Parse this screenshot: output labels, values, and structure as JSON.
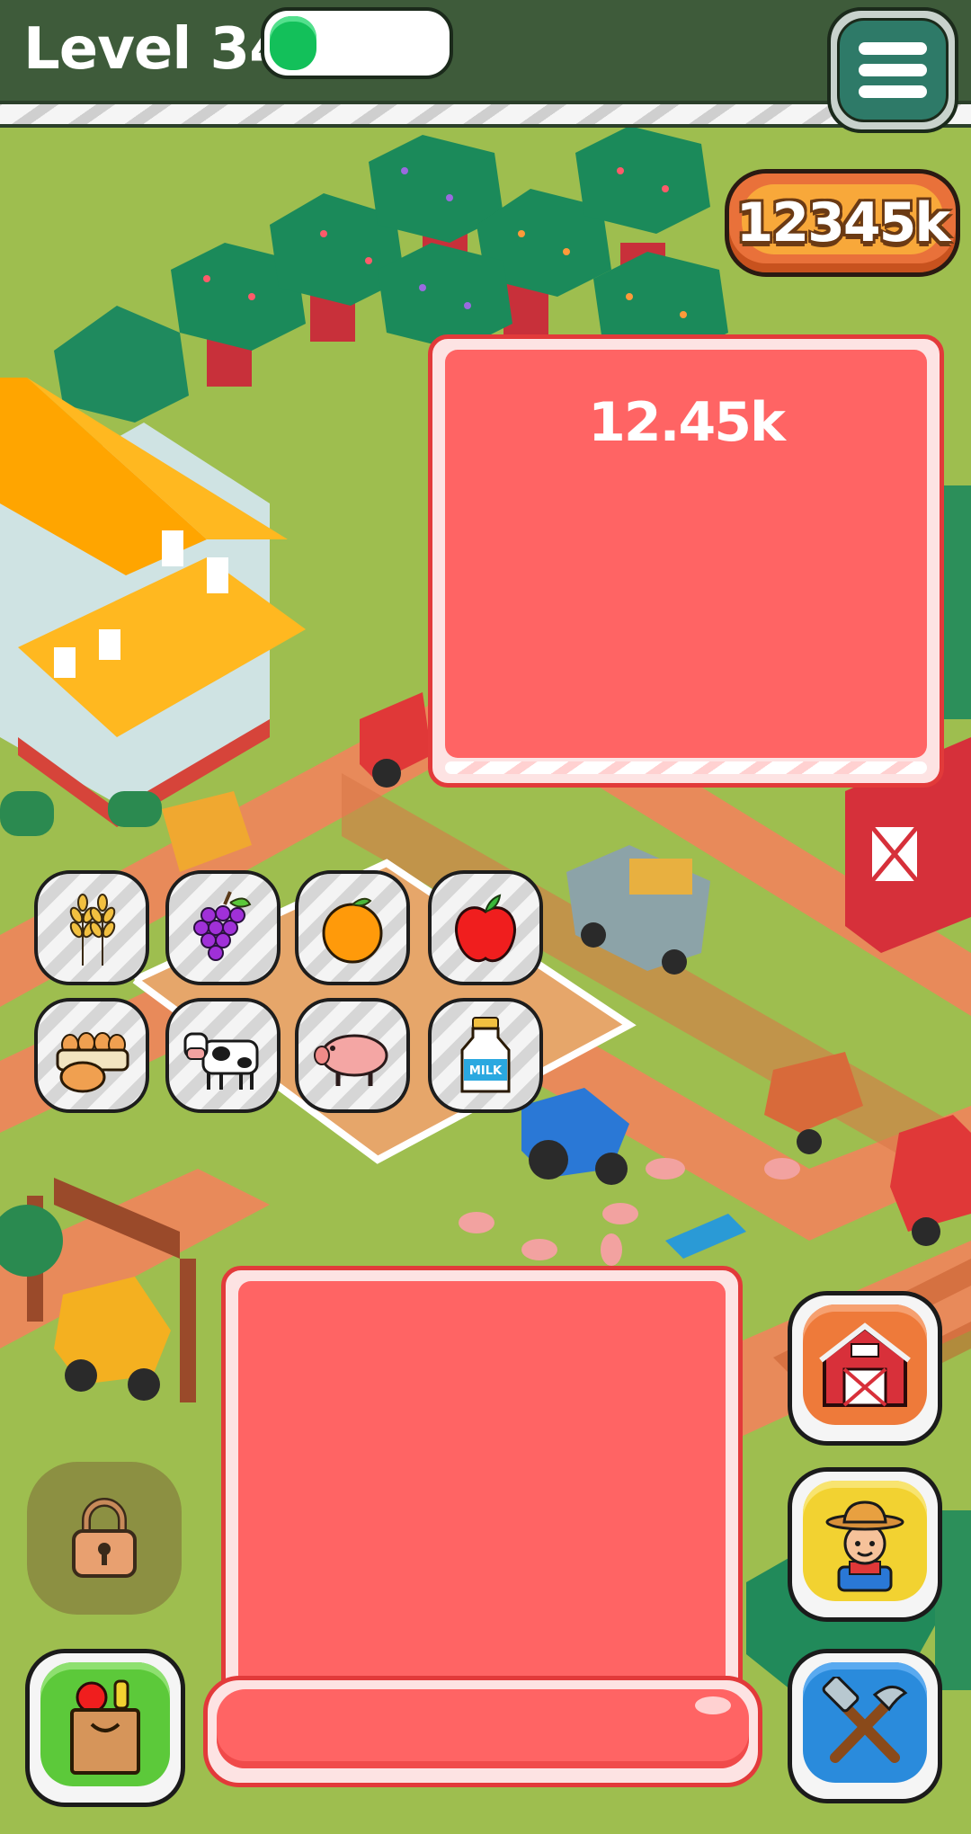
{
  "hud": {
    "level_label": "Level 34",
    "level_progress_percent": 28,
    "coins": "12345k"
  },
  "popup": {
    "value": "12.45k"
  },
  "products": [
    {
      "name": "wheat-icon"
    },
    {
      "name": "grapes-icon"
    },
    {
      "name": "orange-icon"
    },
    {
      "name": "apple-icon"
    },
    {
      "name": "eggs-icon"
    },
    {
      "name": "cow-icon"
    },
    {
      "name": "pig-icon"
    },
    {
      "name": "milk-bottle-icon",
      "label": "MILK"
    }
  ],
  "colors": {
    "panel_red": "#ff6464",
    "panel_border": "#e23a3a",
    "top_bar": "#3e5b3a",
    "grass": "#9ebe4f",
    "coin_orange": "#f8a83a",
    "barn_button": "#ee7a3a",
    "farmer_button": "#f2d231",
    "tools_button": "#2a8bdc",
    "market_button": "#5cc93a"
  }
}
